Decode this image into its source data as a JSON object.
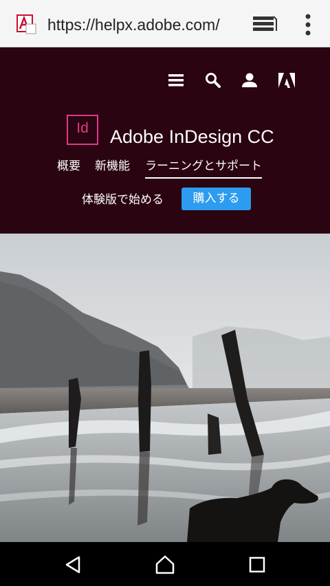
{
  "browser": {
    "url": "https://helpx.adobe.com/",
    "favicon": "adobe-acrobat-icon",
    "tabs_icon": "tabs-icon",
    "overflow_icon": "overflow-menu-icon"
  },
  "header": {
    "icons": [
      "menu-icon",
      "search-icon",
      "user-icon",
      "adobe-logo-icon"
    ],
    "product_icon_text": "Id",
    "product_title": "Adobe InDesign CC",
    "nav": {
      "overview": "概要",
      "new_features": "新機能",
      "learning_support": "ラーニングとサポート"
    },
    "trial_label": "体験版で始める",
    "buy_label": "購入する",
    "colors": {
      "header_bg": "#2a0410",
      "product_accent": "#e3378d",
      "buy_button": "#2d9cf0"
    }
  },
  "hero": {
    "image": "misty beach with wooden posts and a dog silhouette"
  },
  "android_nav": {
    "keys": [
      "back-icon",
      "home-icon",
      "recents-icon"
    ]
  }
}
